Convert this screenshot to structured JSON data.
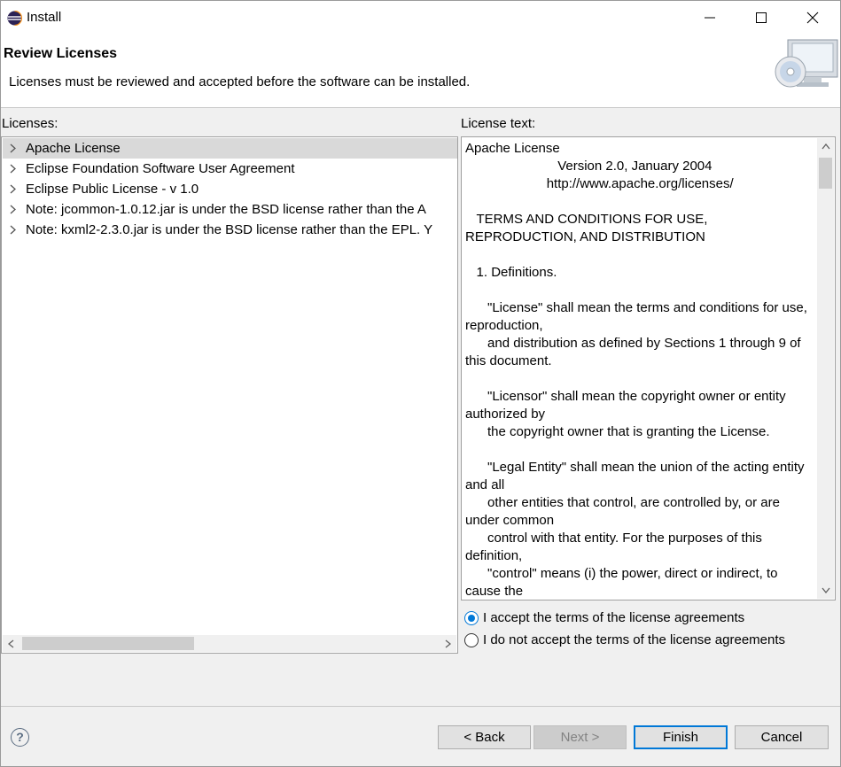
{
  "window": {
    "title": "Install"
  },
  "header": {
    "title": "Review Licenses",
    "description": "Licenses must be reviewed and accepted before the software can be installed."
  },
  "licenses": {
    "label": "Licenses:",
    "items": [
      {
        "label": "Apache License",
        "selected": true
      },
      {
        "label": "Eclipse Foundation Software User Agreement",
        "selected": false
      },
      {
        "label": "Eclipse Public License - v 1.0",
        "selected": false
      },
      {
        "label": "Note:  jcommon-1.0.12.jar is under the BSD license rather than the A",
        "selected": false
      },
      {
        "label": "Note:  kxml2-2.3.0.jar is under the BSD license rather than the EPL.  Y",
        "selected": false
      }
    ]
  },
  "license_text": {
    "label": "License text:",
    "content": "Apache License\n                         Version 2.0, January 2004\n                      http://www.apache.org/licenses/\n\n   TERMS AND CONDITIONS FOR USE, REPRODUCTION, AND DISTRIBUTION\n\n   1. Definitions.\n\n      \"License\" shall mean the terms and conditions for use, reproduction,\n      and distribution as defined by Sections 1 through 9 of this document.\n\n      \"Licensor\" shall mean the copyright owner or entity authorized by\n      the copyright owner that is granting the License.\n\n      \"Legal Entity\" shall mean the union of the acting entity and all\n      other entities that control, are controlled by, or are under common\n      control with that entity. For the purposes of this definition,\n      \"control\" means (i) the power, direct or indirect, to cause the"
  },
  "agreement": {
    "accept": "I accept the terms of the license agreements",
    "decline": "I do not accept the terms of the license agreements",
    "selected": "accept"
  },
  "buttons": {
    "back": "< Back",
    "next": "Next >",
    "finish": "Finish",
    "cancel": "Cancel"
  }
}
